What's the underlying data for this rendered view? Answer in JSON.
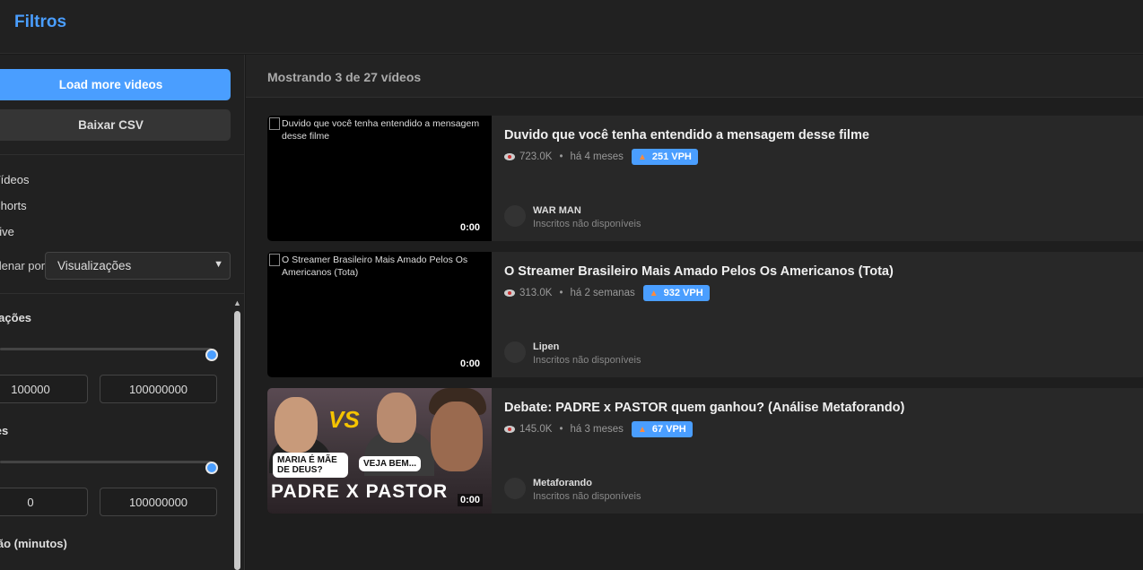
{
  "header": {
    "title": "Filtros"
  },
  "sidebar": {
    "load_more_label": "Load more videos",
    "csv_label": "Baixar CSV",
    "types": [
      "Vídeos",
      "Shorts",
      "Live"
    ],
    "sort_label": "Ordenar por:",
    "sort_value": "Visualizações",
    "views": {
      "title": "Visualizações",
      "min": "100000",
      "max": "100000000"
    },
    "likes": {
      "title": "Likes",
      "min": "0",
      "max": "100000000"
    },
    "duration": {
      "title": "Duração (minutos)"
    }
  },
  "main": {
    "summary": "Mostrando 3 de 27 vídeos",
    "videos": [
      {
        "title": "Duvido que você tenha entendido a mensagem desse filme",
        "thumb_alt": "Duvido que você tenha entendido a mensagem desse filme",
        "duration": "0:00",
        "views": "723.0K",
        "age": "há 4 meses",
        "vph": "251 VPH",
        "channel": "WAR MAN",
        "subs": "Inscritos não disponíveis"
      },
      {
        "title": "O Streamer Brasileiro Mais Amado Pelos Os Americanos (Tota)",
        "thumb_alt": "O Streamer Brasileiro Mais Amado Pelos Os Americanos (Tota)",
        "duration": "0:00",
        "views": "313.0K",
        "age": "há 2 semanas",
        "vph": "932 VPH",
        "channel": "Lipen",
        "subs": "Inscritos não disponíveis"
      },
      {
        "title": "Debate: PADRE x PASTOR quem ganhou? (Análise Metaforando)",
        "duration": "0:00",
        "views": "145.0K",
        "age": "há 3 meses",
        "vph": "67 VPH",
        "channel": "Metaforando",
        "subs": "Inscritos não disponíveis",
        "thumb_text": {
          "vs": "VS",
          "bubble1": "MARIA É MÃE DE DEUS?",
          "bubble2": "VEJA BEM...",
          "caption": "PADRE X PASTOR"
        }
      }
    ]
  },
  "colors": {
    "accent": "#4a9eff",
    "background": "#1a1a1a",
    "card": "#282828"
  }
}
